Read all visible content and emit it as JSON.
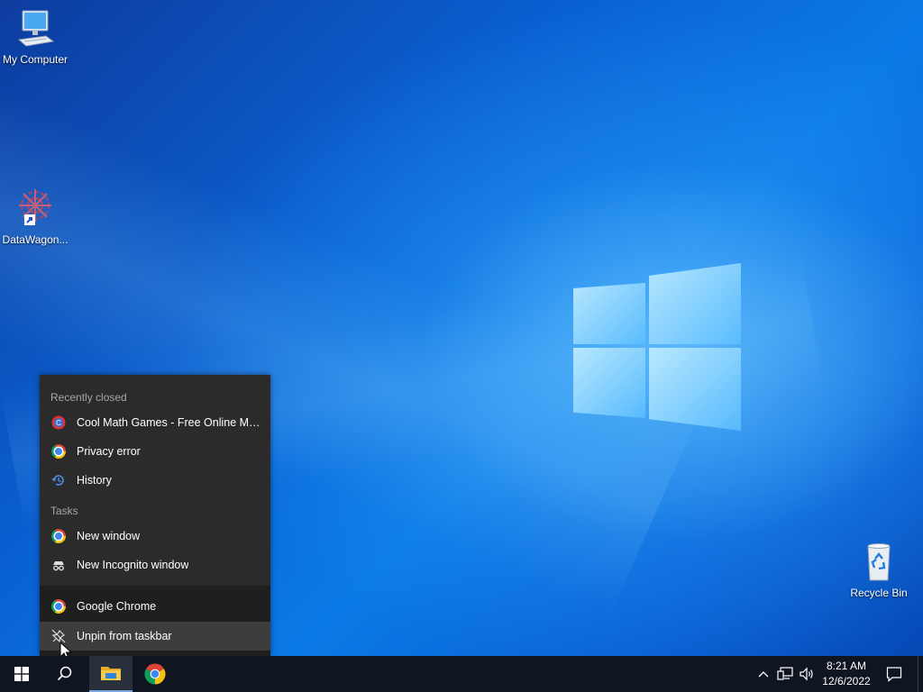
{
  "desktop": {
    "icons": [
      {
        "label": "My Computer",
        "icon": "computer-icon"
      },
      {
        "label": "DataWagon...",
        "icon": "datawagon-shortcut-icon"
      },
      {
        "label": "Recycle Bin",
        "icon": "recycle-bin-icon"
      }
    ]
  },
  "jumplist": {
    "recently_closed_header": "Recently closed",
    "recent": [
      {
        "label": "Cool Math Games - Free Online Math...",
        "icon": "coolmath-icon"
      },
      {
        "label": "Privacy error",
        "icon": "chrome-icon"
      },
      {
        "label": "History",
        "icon": "history-icon"
      }
    ],
    "tasks_header": "Tasks",
    "tasks": [
      {
        "label": "New window",
        "icon": "chrome-icon"
      },
      {
        "label": "New Incognito window",
        "icon": "incognito-icon"
      }
    ],
    "app": {
      "label": "Google Chrome",
      "icon": "chrome-icon"
    },
    "unpin": {
      "label": "Unpin from taskbar",
      "icon": "unpin-icon"
    }
  },
  "taskbar": {
    "start": "start-icon",
    "search": "search-icon",
    "pinned": [
      "file-explorer-icon",
      "chrome-icon"
    ],
    "tray": {
      "time": "8:21 AM",
      "date": "12/6/2022"
    }
  }
}
